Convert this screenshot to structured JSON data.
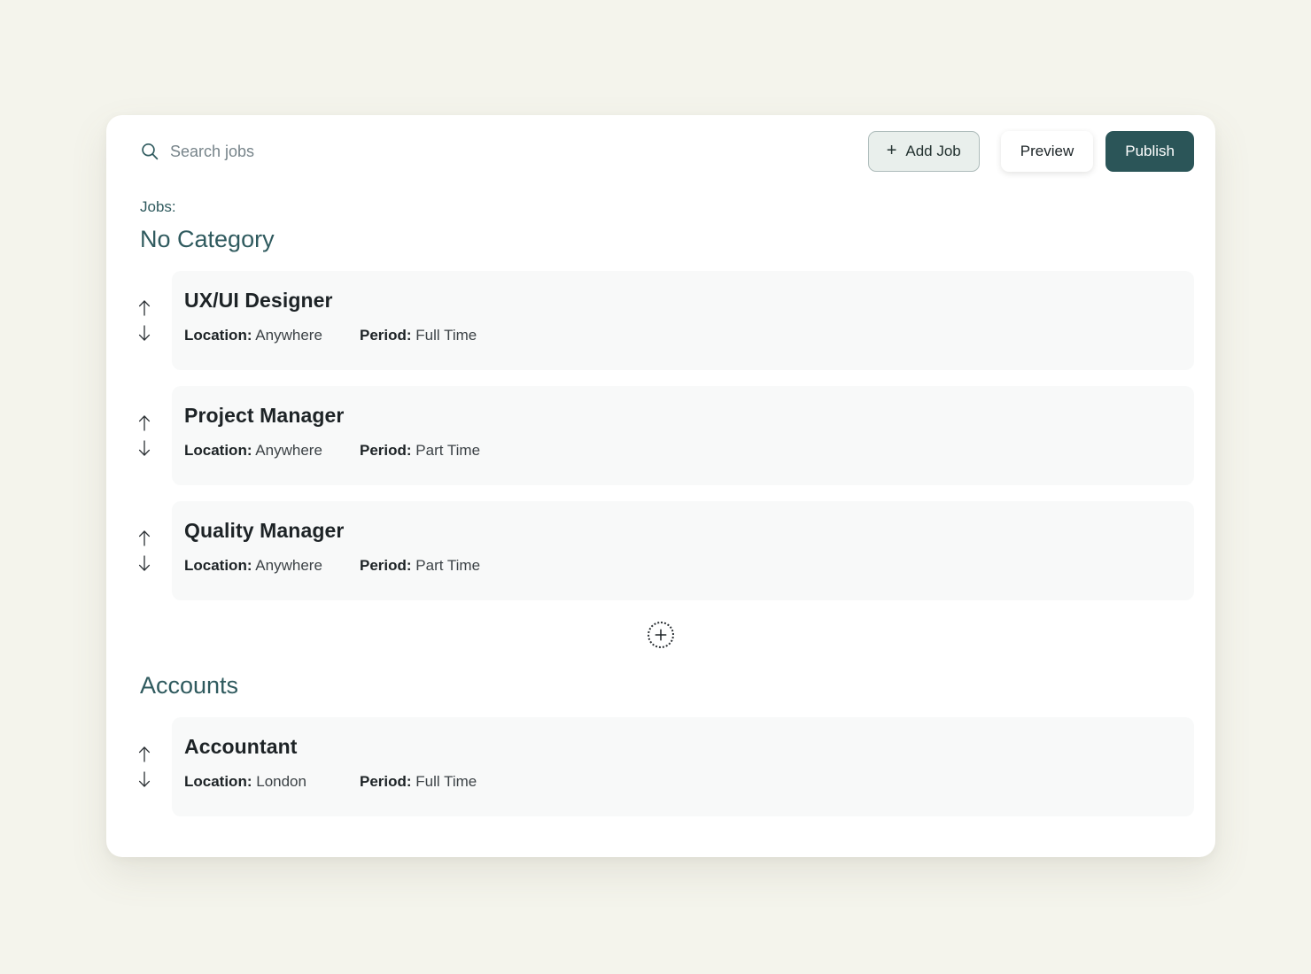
{
  "search": {
    "placeholder": "Search jobs",
    "value": "",
    "icon": "search-icon"
  },
  "toolbar": {
    "add_job_label": "Add Job",
    "add_job_icon": "plus-icon",
    "preview_label": "Preview",
    "publish_label": "Publish"
  },
  "colors": {
    "page_background": "#f4f4ec",
    "panel_background": "#ffffff",
    "accent_teal": "#2f5a5e",
    "publish_button": "#2b5558",
    "add_job_button": "#e9efec",
    "job_card": "#f8f9f9"
  },
  "content": {
    "jobs_label": "Jobs:",
    "sections": [
      {
        "heading": "No Category",
        "jobs": [
          {
            "title": "UX/UI Designer",
            "location_key": "Location:",
            "location_value": "Anywhere",
            "period_key": "Period:",
            "period_value": "Full Time"
          },
          {
            "title": "Project Manager",
            "location_key": "Location:",
            "location_value": "Anywhere",
            "period_key": "Period:",
            "period_value": "Part Time"
          },
          {
            "title": "Quality Manager",
            "location_key": "Location:",
            "location_value": "Anywhere",
            "period_key": "Period:",
            "period_value": "Part Time"
          }
        ],
        "has_add_button": true
      },
      {
        "heading": "Accounts",
        "jobs": [
          {
            "title": "Accountant",
            "location_key": "Location:",
            "location_value": "London",
            "period_key": "Period:",
            "period_value": "Full Time"
          }
        ],
        "has_add_button": false
      }
    ]
  },
  "icons": {
    "move_up": "arrow-up-icon",
    "move_down": "arrow-down-icon",
    "add": "plus-circle-icon"
  }
}
